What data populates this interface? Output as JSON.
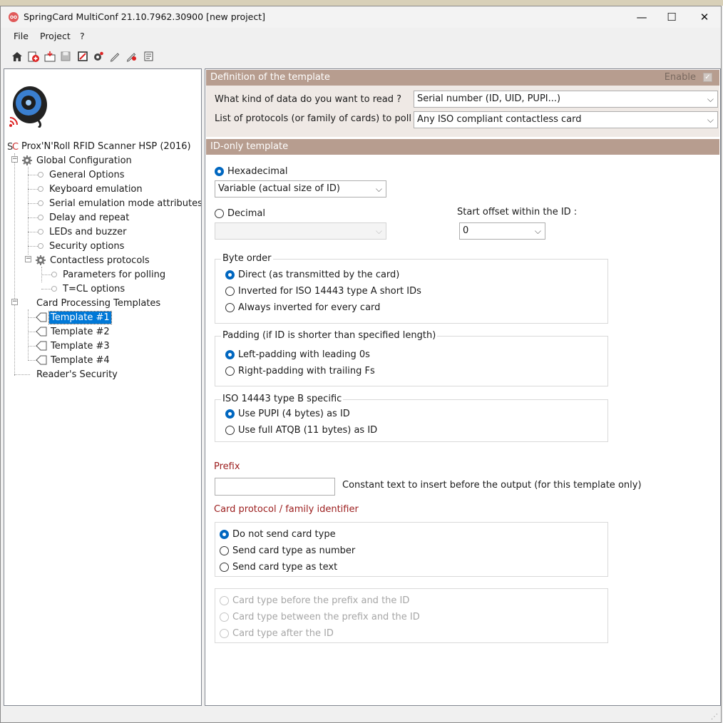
{
  "window": {
    "title": "SpringCard MultiConf 21.10.7962.30900 [new project]",
    "minimize": "—",
    "maximize": "☐",
    "close": "✕"
  },
  "menu": [
    "File",
    "Project",
    "?"
  ],
  "toolbar_icons": [
    "home-icon",
    "new-icon",
    "open-icon",
    "save-icon",
    "export-icon",
    "reader-icon",
    "edit-icon",
    "write-icon",
    "report-icon"
  ],
  "tree": {
    "root": "Prox'N'Roll RFID Scanner HSP (2016)",
    "global": "Global Configuration",
    "general": "General Options",
    "keyboard": "Keyboard emulation",
    "serial": "Serial emulation mode attributes",
    "delay": "Delay and repeat",
    "leds": "LEDs and buzzer",
    "security": "Security options",
    "contactless": "Contactless protocols",
    "polling": "Parameters for polling",
    "tcl": "T=CL options",
    "templates": "Card Processing Templates",
    "t1": "Template #1",
    "t2": "Template #2",
    "t3": "Template #3",
    "t4": "Template #4",
    "reader_security": "Reader's Security"
  },
  "definition": {
    "header": "Definition of the template",
    "enable": "Enable",
    "data_question": "What kind of data do you want to read ?",
    "data_value": "Serial number (ID, UID, PUPI...)",
    "protocols_question": "List of protocols (or family of cards) to poll :",
    "protocols_value": "Any ISO compliant contactless card"
  },
  "id_only": {
    "header": "ID-only template",
    "hex_label": "Hexadecimal",
    "hex_value": "Variable (actual size of ID)",
    "dec_label": "Decimal",
    "dec_value": "",
    "offset_label": "Start offset within the ID :",
    "offset_value": "0"
  },
  "byte_order": {
    "title": "Byte order",
    "options": [
      "Direct (as transmitted by the card)",
      "Inverted for ISO 14443 type A short IDs",
      "Always inverted for every card"
    ]
  },
  "padding": {
    "title": "Padding (if ID is shorter than specified length)",
    "options": [
      "Left-padding with leading 0s",
      "Right-padding with trailing Fs"
    ]
  },
  "iso_b": {
    "title": "ISO 14443 type B specific",
    "options": [
      "Use PUPI (4 bytes) as ID",
      "Use full ATQB (11 bytes) as ID"
    ]
  },
  "prefix": {
    "label": "Prefix",
    "value": "",
    "hint": "Constant text to insert before the output (for this template only)"
  },
  "card_id": {
    "label": "Card protocol / family identifier",
    "options": [
      "Do not send card type",
      "Send card type as number",
      "Send card type as text"
    ],
    "position_options": [
      "Card type before the prefix and the ID",
      "Card type between the prefix and the ID",
      "Card type after the ID"
    ]
  },
  "colors": {
    "section_header": "#b79d8f",
    "selection": "#0078d7",
    "radio_checked": "#0067c0",
    "red_label": "#9b1c1c"
  }
}
